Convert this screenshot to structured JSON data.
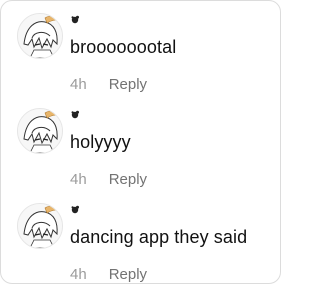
{
  "comments": [
    {
      "text": "broooooootal",
      "timestamp": "4h",
      "reply_label": "Reply",
      "avatar_icon": "anime-character-avatar"
    },
    {
      "text": "holyyyy",
      "timestamp": "4h",
      "reply_label": "Reply",
      "avatar_icon": "anime-character-avatar"
    },
    {
      "text": "dancing app they said",
      "timestamp": "4h",
      "reply_label": "Reply",
      "avatar_icon": "anime-character-avatar"
    }
  ],
  "colors": {
    "text": "#111111",
    "meta": "#8e8e8e",
    "reply": "#737373",
    "border": "#dcdcdc"
  }
}
